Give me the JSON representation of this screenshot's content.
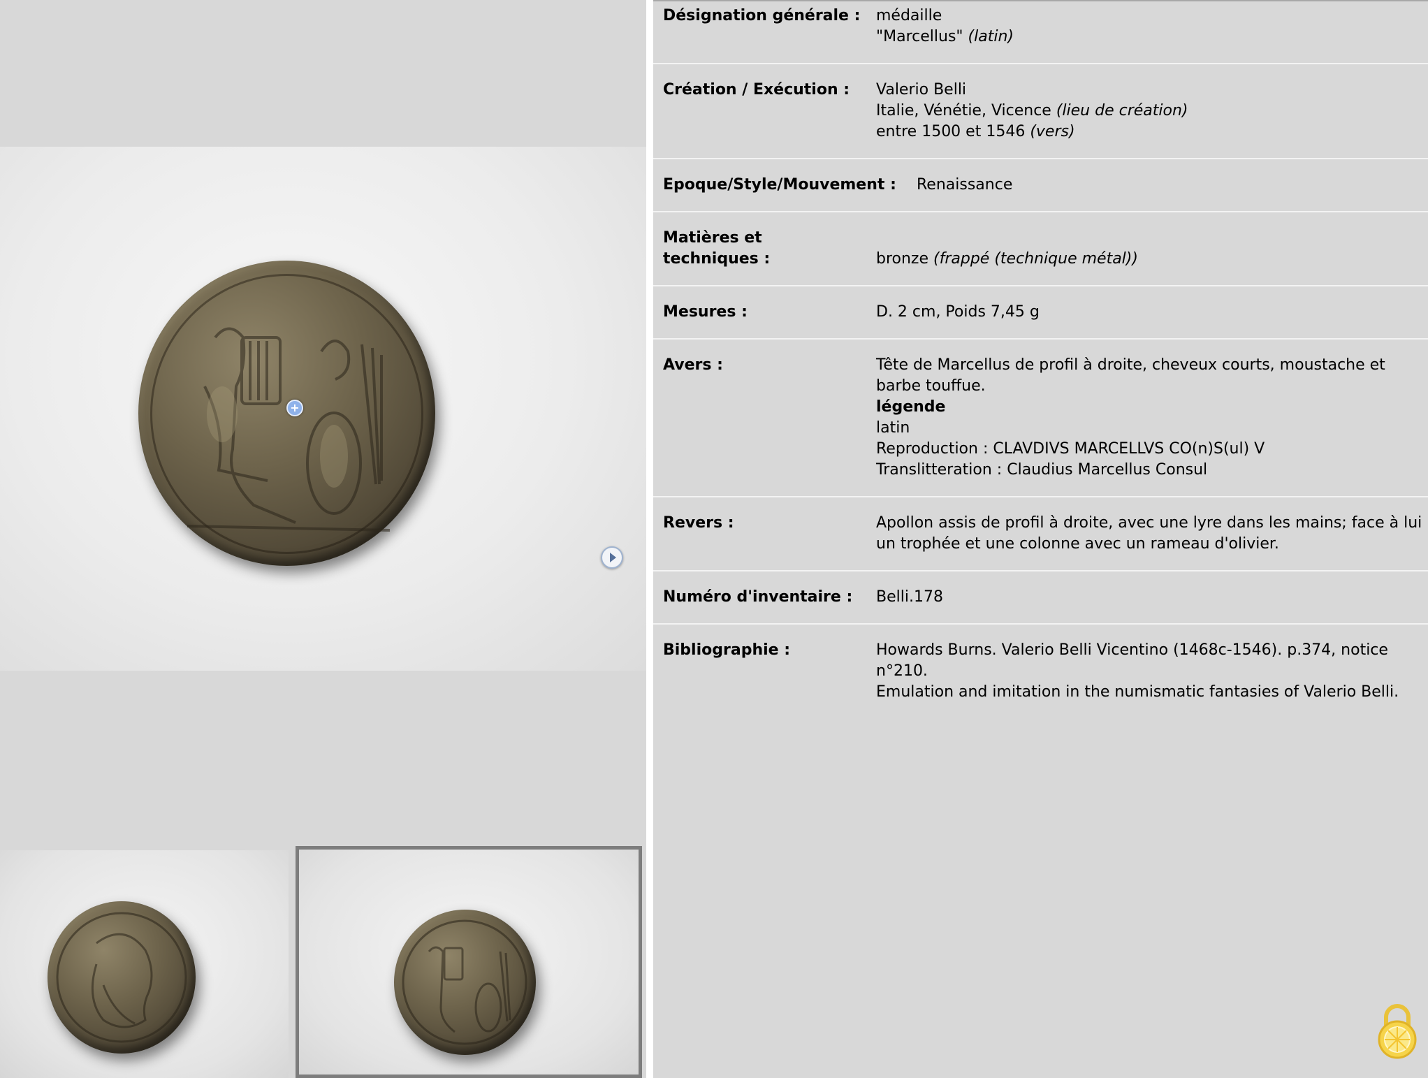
{
  "images": {
    "main_alt": "Revers : Apollon assis avec une lyre",
    "thumb_obverse_alt": "Avers : Tête de Marcellus",
    "thumb_reverse_alt": "Revers"
  },
  "icons": {
    "zoom": "zoom-marker-icon",
    "next": "next-arrow-icon",
    "lock": "lemon-lock-icon"
  },
  "record": {
    "designation": {
      "label": "Désignation générale :",
      "line1": "médaille",
      "line2_text": "\"Marcellus\"",
      "line2_note": "(latin)"
    },
    "creation": {
      "label": "Création / Exécution :",
      "line1": "Valerio Belli",
      "line2_text": "Italie, Vénétie, Vicence",
      "line2_note": "(lieu de création)",
      "line3_text": "entre 1500 et 1546",
      "line3_note": "(vers)"
    },
    "epoque": {
      "label": "Epoque/Style/Mouvement :",
      "value": "Renaissance"
    },
    "matieres": {
      "label_line1": "Matières et",
      "label_line2": "techniques :",
      "value_text": "bronze",
      "value_note": "(frappé (technique métal))"
    },
    "mesures": {
      "label": "Mesures :",
      "value": "D. 2 cm, Poids 7,45 g"
    },
    "avers": {
      "label": "Avers :",
      "line1": "Tête de Marcellus de profil à droite, cheveux courts, moustache et",
      "line2": "barbe touffue.",
      "legend_title": "légende",
      "line4": "latin",
      "line5": "Reproduction : CLAVDIVS MARCELLVS CO(n)S(ul) V",
      "line6": "Translitteration : Claudius Marcellus Consul"
    },
    "revers": {
      "label": "Revers :",
      "line1": "Apollon assis de profil à droite, avec une lyre dans les mains; face à lui",
      "line2": "un trophée et une colonne avec un rameau d'olivier."
    },
    "inventaire": {
      "label": "Numéro d'inventaire :",
      "value": "Belli.178"
    },
    "bibliographie": {
      "label": "Bibliographie :",
      "line1": "Howards Burns. Valerio Belli Vicentino (1468c-1546). p.374, notice",
      "line2": "n°210.",
      "line3": "Emulation and imitation in the numismatic fantasies of Valerio Belli."
    }
  }
}
